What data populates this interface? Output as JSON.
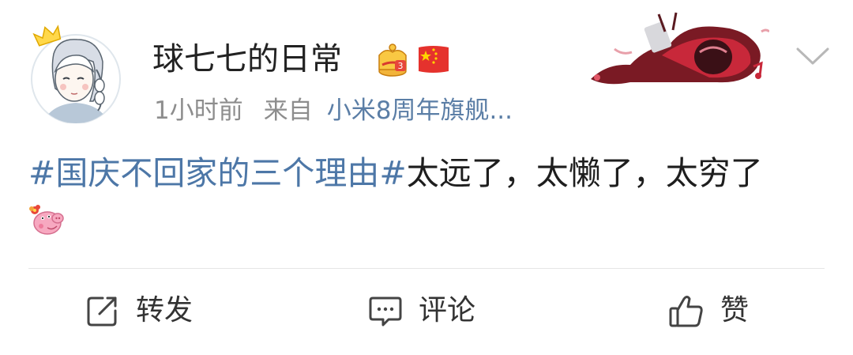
{
  "user": {
    "name": "球七七的日常",
    "time": "1小时前",
    "from_label": "来自",
    "source": "小米8周年旗舰...",
    "avatar_icon": "girl-with-crown-avatar",
    "badge_icon": "vip-crown-badge-icon",
    "flag_icon": "china-flag-icon"
  },
  "post": {
    "hashtag": "#国庆不回家的三个理由#",
    "text": "太远了，太懒了，太穷了",
    "emoji": "peppa-pig-emoji"
  },
  "actions": {
    "repost_label": "转发",
    "comment_label": "评论",
    "like_label": "赞"
  },
  "colors": {
    "link": "#4d77a7",
    "meta": "#8d8d8d",
    "text": "#1e1e1e"
  }
}
